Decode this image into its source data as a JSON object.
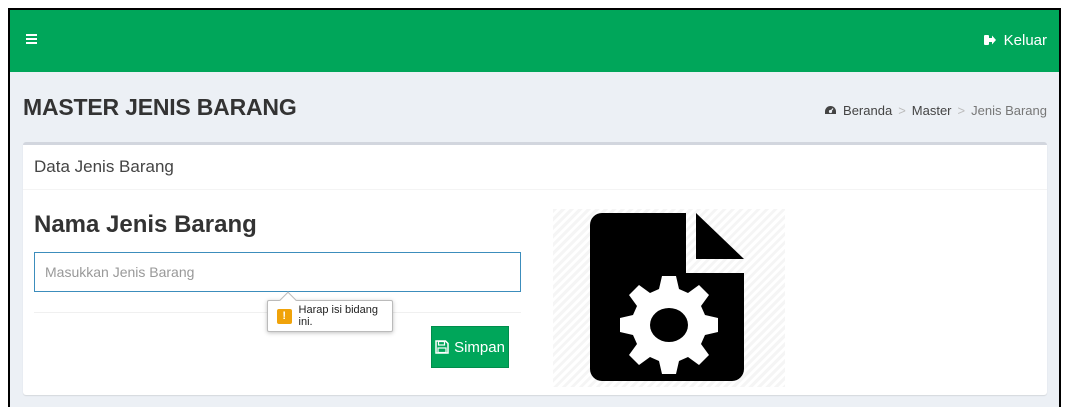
{
  "topbar": {
    "menu_icon": "hamburger-icon",
    "logout_label": "Keluar",
    "logout_icon": "sign-out-icon",
    "bg_color": "#00a65a"
  },
  "header": {
    "title": "MASTER JENIS BARANG",
    "breadcrumb": {
      "home_icon": "dashboard-icon",
      "items": [
        "Beranda",
        "Master",
        "Jenis Barang"
      ],
      "separator": ">"
    }
  },
  "box": {
    "title": "Data Jenis Barang",
    "field_label": "Nama Jenis Barang",
    "input": {
      "value": "",
      "placeholder": "Masukkan Jenis Barang"
    },
    "validation_tooltip": {
      "icon": "warning-icon",
      "message": "Harap isi bidang ini."
    },
    "save_button": {
      "label": "Simpan",
      "icon": "floppy-disk-icon"
    },
    "illustration_icon": "file-settings-icon"
  }
}
